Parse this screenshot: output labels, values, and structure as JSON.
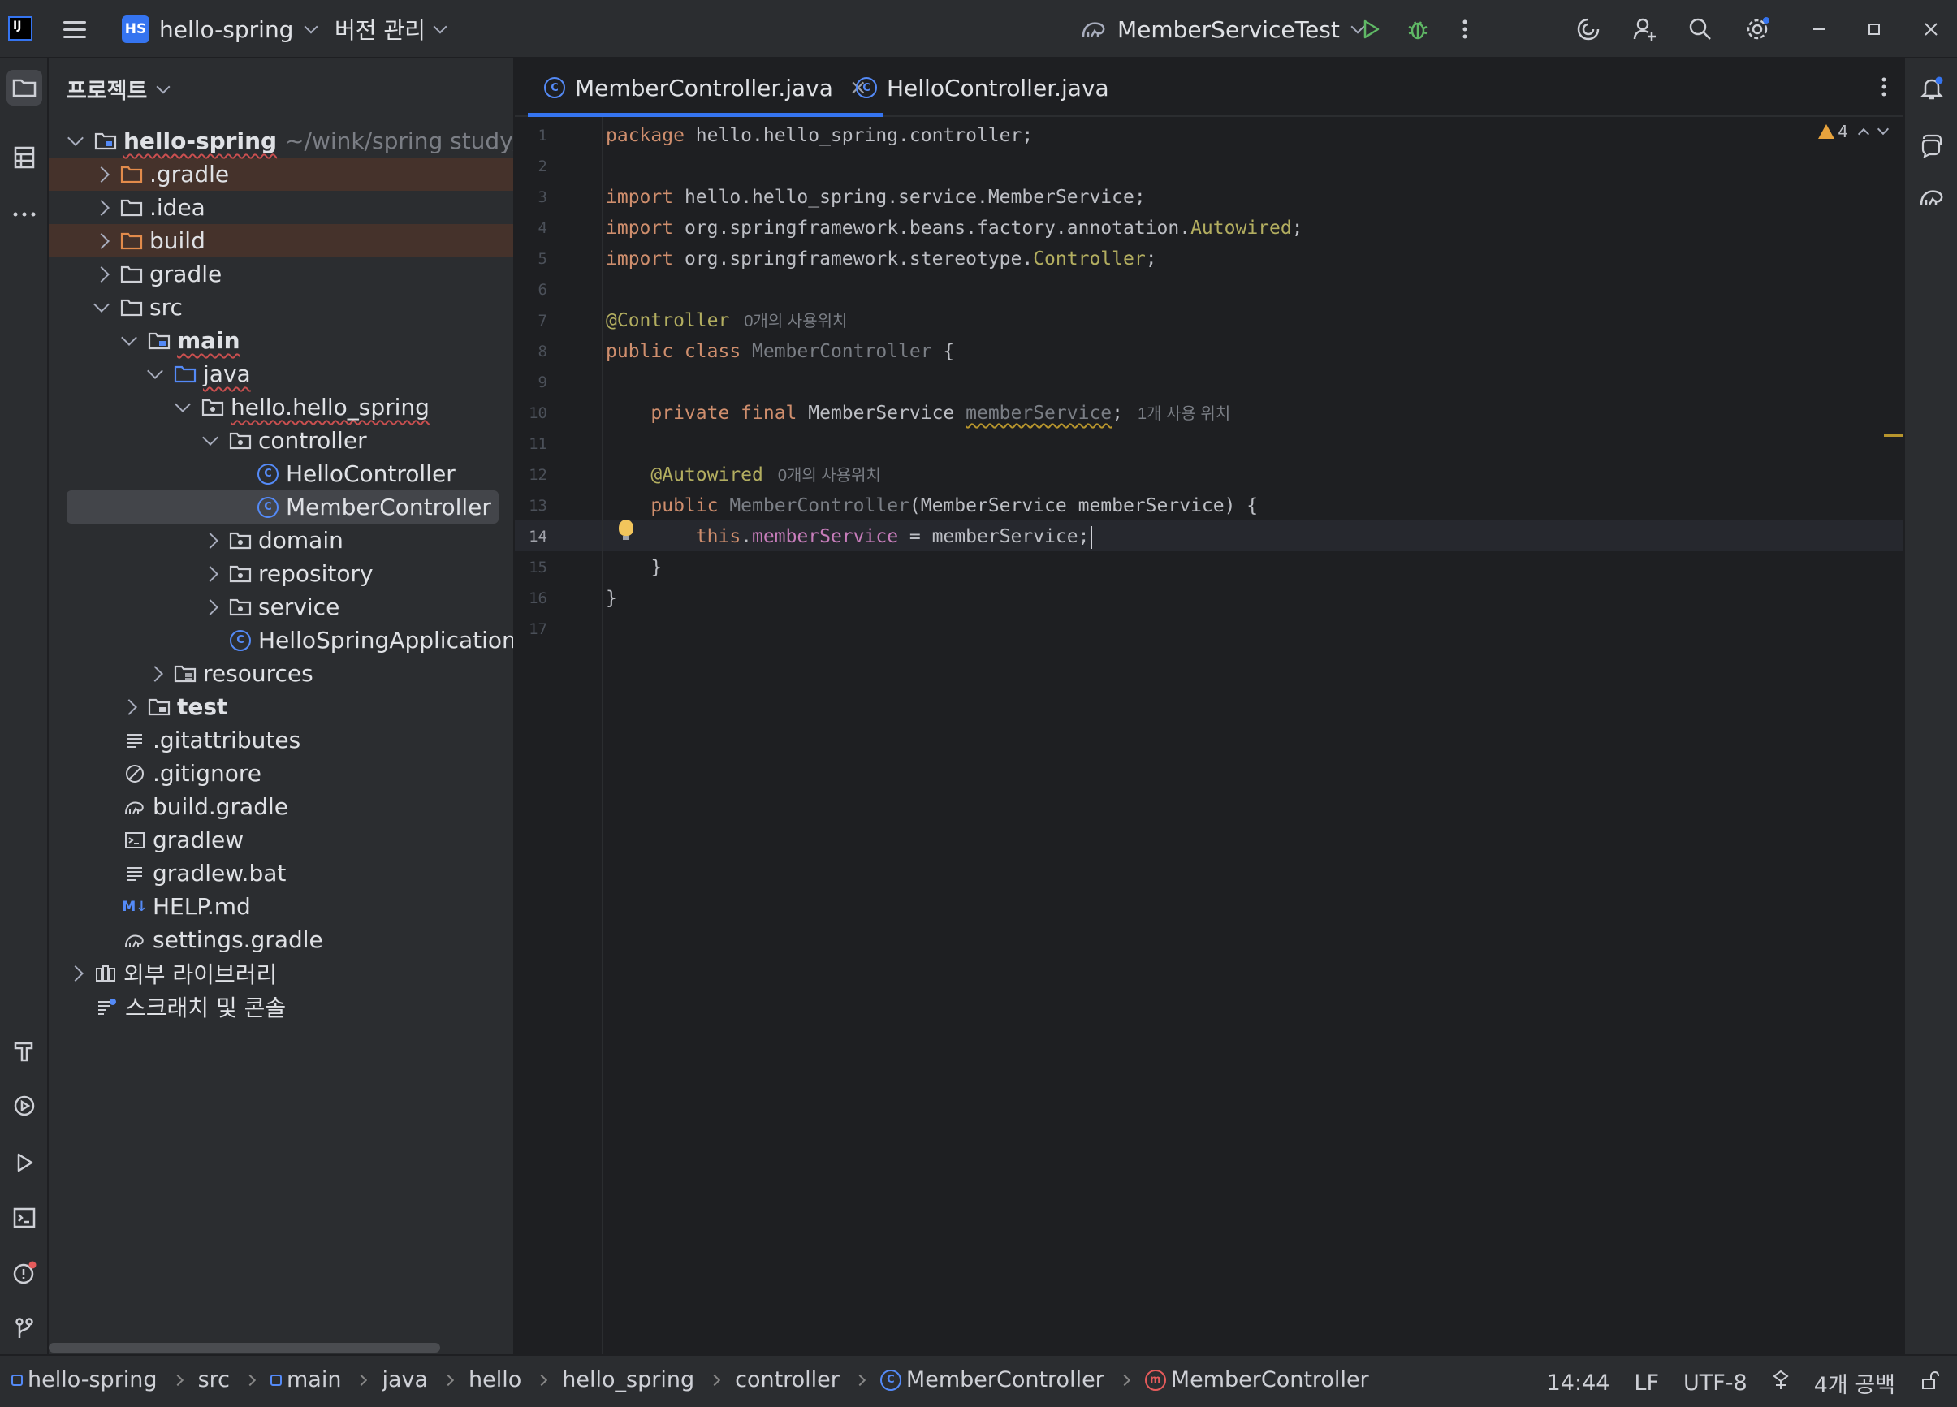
{
  "titlebar": {
    "logo_text": "IJ",
    "project_badge": "HS",
    "project_name": "hello-spring",
    "vcs_label": "버전 관리",
    "run_config": "MemberServiceTest"
  },
  "project_panel": {
    "header": "프로젝트",
    "tree": [
      {
        "label": "hello-spring",
        "extra": "~/wink/spring study/hello-"
      },
      {
        "label": ".gradle"
      },
      {
        "label": ".idea"
      },
      {
        "label": "build"
      },
      {
        "label": "gradle"
      },
      {
        "label": "src"
      },
      {
        "label": "main"
      },
      {
        "label": "java"
      },
      {
        "label": "hello.hello_spring"
      },
      {
        "label": "controller"
      },
      {
        "label": "HelloController"
      },
      {
        "label": "MemberController"
      },
      {
        "label": "domain"
      },
      {
        "label": "repository"
      },
      {
        "label": "service"
      },
      {
        "label": "HelloSpringApplication"
      },
      {
        "label": "resources"
      },
      {
        "label": "test"
      },
      {
        "label": ".gitattributes"
      },
      {
        "label": ".gitignore"
      },
      {
        "label": "build.gradle"
      },
      {
        "label": "gradlew"
      },
      {
        "label": "gradlew.bat"
      },
      {
        "label": "HELP.md",
        "icon_text": "M↓"
      },
      {
        "label": "settings.gradle"
      },
      {
        "label": "외부 라이브러리"
      },
      {
        "label": "스크래치 및 콘솔"
      }
    ]
  },
  "tabs": [
    {
      "label": "MemberController.java",
      "icon": "C",
      "close": "×"
    },
    {
      "label": "HelloController.java",
      "icon": "C"
    }
  ],
  "editor": {
    "line_numbers": [
      "1",
      "2",
      "3",
      "4",
      "5",
      "6",
      "7",
      "8",
      "9",
      "10",
      "11",
      "12",
      "13",
      "14",
      "15",
      "16",
      "17"
    ],
    "warning_count": "4",
    "hints": {
      "controller_usages": "0개의 사용위치",
      "field_usages": "1개 사용 위치",
      "autowired_usages": "0개의 사용위치"
    },
    "code": {
      "l1_kw": "package",
      "l1_rest": " hello.hello_spring.controller;",
      "l3_kw": "import",
      "l3_rest": " hello.hello_spring.service.MemberService;",
      "l4_kw": "import",
      "l4_rest": " org.springframework.beans.factory.annotation.",
      "l4_ann": "Autowired",
      "l4_end": ";",
      "l5_kw": "import",
      "l5_rest": " org.springframework.stereotype.",
      "l5_ann": "Controller",
      "l5_end": ";",
      "l7_ann": "@Controller",
      "l8_kw": "public class",
      "l8_name": " MemberController",
      "l8_end": " {",
      "l10_kw": "    private final",
      "l10_type": " MemberService ",
      "l10_field": "memberService",
      "l10_end": ";",
      "l12_ann": "    @Autowired",
      "l13_kw": "    public",
      "l13_name": " MemberController",
      "l13_rest": "(MemberService memberService) {",
      "l14_kw": "        this",
      "l14_dot": ".",
      "l14_field": "memberService",
      "l14_rest": " = memberService;",
      "l15": "    }",
      "l16": "}"
    }
  },
  "statusbar": {
    "crumbs": [
      "hello-spring",
      "src",
      "main",
      "java",
      "hello",
      "hello_spring",
      "controller",
      "MemberController",
      "MemberController"
    ],
    "crumb_icons": {
      "class": "C",
      "method": "m"
    },
    "position": "14:44",
    "line_sep": "LF",
    "encoding": "UTF-8",
    "indent": "4개 공백"
  }
}
